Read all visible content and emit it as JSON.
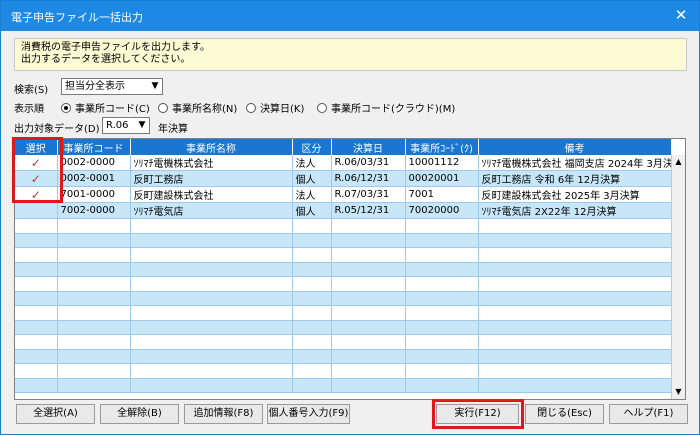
{
  "window": {
    "title": "電子申告ファイル一括出力",
    "close_label": "✕"
  },
  "info": {
    "line1": "消費税の電子申告ファイルを出力します。",
    "line2": "出力するデータを選択してください。"
  },
  "search": {
    "label": "検索(S)",
    "value": "担当分全表示"
  },
  "sort": {
    "label": "表示順",
    "options": [
      "事業所コード(C)",
      "事業所名称(N)",
      "決算日(K)",
      "事業所コード(クラウド)(M)"
    ],
    "selected": 0
  },
  "output": {
    "label": "出力対象データ(D)",
    "value": "R.06",
    "suffix": "年決算"
  },
  "table": {
    "headers": [
      "選択",
      "事業所コード",
      "事業所名称",
      "区分",
      "決算日",
      "事業所ｺｰﾄﾞ(ｸ)",
      "備考"
    ],
    "rows": [
      {
        "check": "✓",
        "code": "0002-0000",
        "name": "ｿﾘﾏﾁ電機株式会社",
        "kubun": "法人",
        "date": "R.06/03/31",
        "cloud": "10001112",
        "note": "ｿﾘﾏﾁ電機株式会社 福岡支店 2024年 3月決"
      },
      {
        "check": "✓",
        "code": "0002-0001",
        "name": "反町工務店",
        "kubun": "個人",
        "date": "R.06/12/31",
        "cloud": "00020001",
        "note": "反町工務店 令和 6年 12月決算"
      },
      {
        "check": "✓",
        "code": "7001-0000",
        "name": "反町建設株式会社",
        "kubun": "法人",
        "date": "R.07/03/31",
        "cloud": "7001",
        "note": "反町建設株式会社 2025年 3月決算"
      },
      {
        "check": "",
        "code": "7002-0000",
        "name": "ｿﾘﾏﾁ電気店",
        "kubun": "個人",
        "date": "R.05/12/31",
        "cloud": "70020000",
        "note": "ｿﾘﾏﾁ電気店 2X22年 12月決算"
      }
    ]
  },
  "buttons": {
    "select_all": "全選択(A)",
    "deselect_all": "全解除(B)",
    "add_info": "追加情報(F8)",
    "personal_number": "個人番号入力(F9)",
    "execute": "実行(F12)",
    "close": "閉じる(Esc)",
    "help": "ヘルプ(F1)"
  },
  "colors": {
    "accent": "#1976d2",
    "highlight": "#e0171b",
    "alt_row": "#c7e7f9"
  }
}
